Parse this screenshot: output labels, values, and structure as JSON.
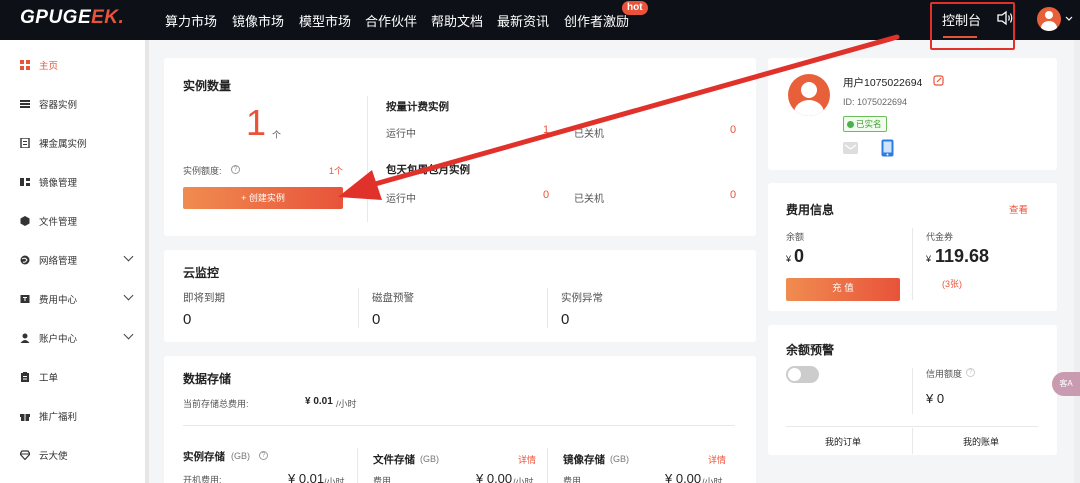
{
  "header": {
    "logo_a": "GPUGE",
    "logo_b": "EK.",
    "nav": [
      "算力市场",
      "镜像市场",
      "模型市场",
      "合作伙伴",
      "帮助文档",
      "最新资讯",
      "创作者激励"
    ],
    "hot_badge": "hot",
    "console": "控制台"
  },
  "sidebar": {
    "items": [
      {
        "label": "主页",
        "icon": "home-grid-icon"
      },
      {
        "label": "容器实例",
        "icon": "list-icon"
      },
      {
        "label": "裸金属实例",
        "icon": "server-icon"
      },
      {
        "label": "镜像管理",
        "icon": "image-icon"
      },
      {
        "label": "文件管理",
        "icon": "file-icon"
      },
      {
        "label": "网络管理",
        "icon": "globe-icon"
      },
      {
        "label": "费用中心",
        "icon": "wallet-icon"
      },
      {
        "label": "账户中心",
        "icon": "user-icon"
      },
      {
        "label": "工单",
        "icon": "ticket-icon"
      },
      {
        "label": "推广福利",
        "icon": "gift-icon"
      },
      {
        "label": "云大使",
        "icon": "diamond-icon"
      }
    ]
  },
  "instances": {
    "title": "实例数量",
    "count": "1",
    "unit": "个",
    "quota_label": "实例额度:",
    "quota_value": "1个",
    "create_button": "+ 创建实例",
    "pay_as_go_title": "按量计费实例",
    "running_label": "运行中",
    "running_value": "1",
    "stopped_label": "已关机",
    "stopped_value": "0",
    "package_title": "包天包周包月实例",
    "pkg_running_label": "运行中",
    "pkg_running_value": "0",
    "pkg_stopped_label": "已关机",
    "pkg_stopped_value": "0"
  },
  "monitor": {
    "title": "云监控",
    "expiring_label": "即将到期",
    "expiring_value": "0",
    "disk_label": "磁盘预警",
    "disk_value": "0",
    "abnormal_label": "实例异常",
    "abnormal_value": "0"
  },
  "storage": {
    "title": "数据存储",
    "total_label": "当前存储总费用:",
    "total_value": "¥ 0.01",
    "total_unit": "/小时",
    "instance_storage": "实例存储",
    "gb": "(GB)",
    "power_on_fee": "开机费用:",
    "instance_fee_value": "¥ 0.01",
    "per_hour": "/小时",
    "file_storage": "文件存储",
    "file_gb": "(GB)",
    "file_details": "详情",
    "file_fee_label": "费用",
    "file_fee_value": "¥ 0.00",
    "file_unit": "/小时",
    "image_storage": "镜像存储",
    "image_gb": "(GB)",
    "image_details": "详情",
    "image_fee_label": "费用",
    "image_fee_value": "¥ 0.00",
    "image_unit": "/小时"
  },
  "profile": {
    "username": "用户1075022694",
    "id": "ID: 1075022694",
    "verified": "已实名"
  },
  "billing": {
    "title": "费用信息",
    "view": "查看",
    "balance_label": "余额",
    "currency": "¥",
    "balance_value": "0",
    "recharge": "充 值",
    "voucher_label": "代金券",
    "voucher_value": "119.68",
    "voucher_count": "(3张)"
  },
  "alert": {
    "title": "余额预警",
    "credit_label": "信用额度",
    "credit_value": "¥ 0",
    "my_orders": "我的订单",
    "my_bills": "我的账单"
  },
  "float_badge": "客A",
  "colors": {
    "accent": "#e8533a",
    "nav_bg": "#0d1117",
    "annotation_red": "#e0322b"
  }
}
